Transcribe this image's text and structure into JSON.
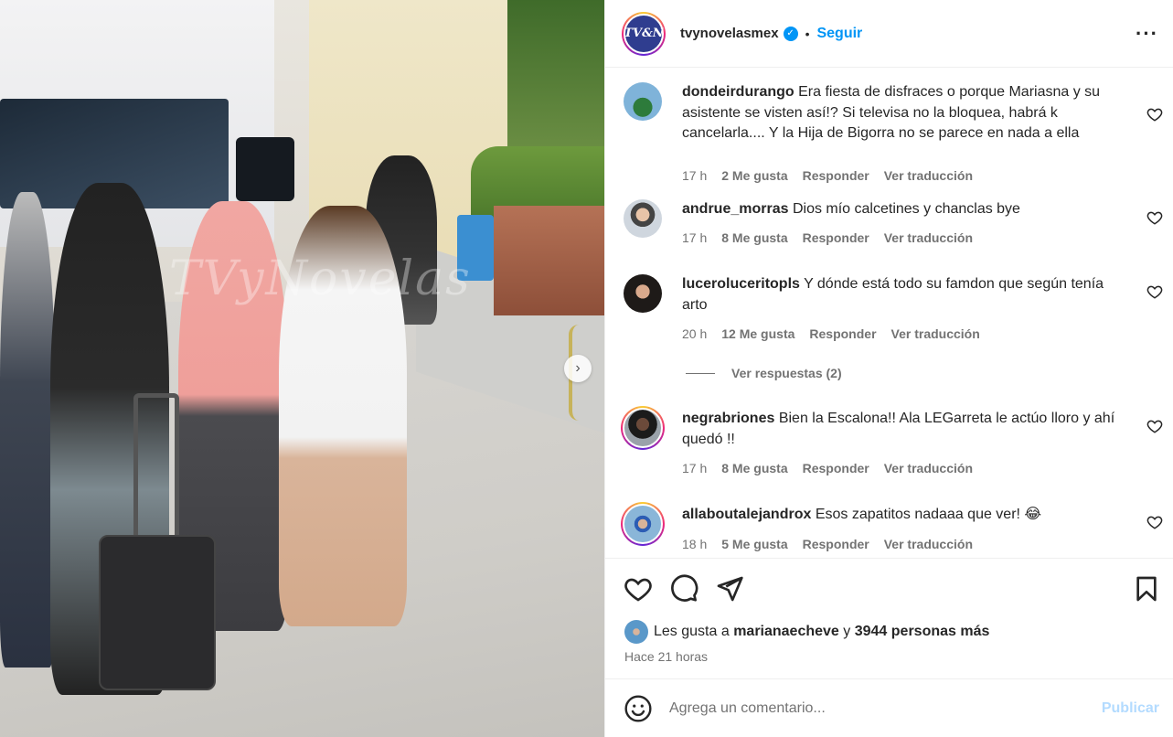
{
  "post": {
    "image_alt": "Street photo",
    "watermark": "TVyNovelas",
    "next_icon": "chevron-right-icon"
  },
  "header": {
    "avatar_text": "TV&N",
    "username": "tvynovelasmex",
    "verified_icon": "verified-badge-icon",
    "separator": "•",
    "follow_label": "Seguir",
    "more_icon": "more-options-icon"
  },
  "comments": [
    {
      "username": "dondeirdurango",
      "text": "Era fiesta de disfraces o porque Mariasna y su asistente se visten así!? Si televisa no la bloquea, habrá k cancelarla.... Y la Hija de Bigorra no se parece en nada a ella",
      "time": "17 h",
      "likes": "2 Me gusta",
      "reply": "Responder",
      "translate": "Ver traducción"
    },
    {
      "username": "andrue_morras",
      "text": "Dios mío calcetines y chanclas bye",
      "time": "17 h",
      "likes": "8 Me gusta",
      "reply": "Responder",
      "translate": "Ver traducción"
    },
    {
      "username": "luceroluceritopls",
      "text": "Y dónde está todo su famdon que según tenía arto",
      "time": "20 h",
      "likes": "12 Me gusta",
      "reply": "Responder",
      "translate": "Ver traducción",
      "view_replies": "Ver respuestas (2)"
    },
    {
      "username": "negrabriones",
      "text": "Bien la Escalona!! Ala LEGarreta le actúo lloro y ahí quedó !!",
      "time": "17 h",
      "likes": "8 Me gusta",
      "reply": "Responder",
      "translate": "Ver traducción"
    },
    {
      "username": "allaboutalejandrox",
      "text": "Esos zapatitos nadaaa que ver! 😂",
      "time": "18 h",
      "likes": "5 Me gusta",
      "reply": "Responder",
      "translate": "Ver traducción"
    }
  ],
  "actions": {
    "like_icon": "heart-icon",
    "comment_icon": "comment-icon",
    "share_icon": "share-icon",
    "save_icon": "bookmark-icon",
    "likes_prefix": "Les gusta a",
    "liked_by": "marianaecheve",
    "likes_and": "y",
    "likes_others": "3944 personas más",
    "time_ago": "Hace 21 horas"
  },
  "composer": {
    "emoji_icon": "emoji-icon",
    "placeholder": "Agrega un comentario...",
    "publish_label": "Publicar"
  },
  "colors": {
    "accent": "#0095f6",
    "publish_disabled": "#b3dbff",
    "meta_gray": "#737373",
    "text": "#262626"
  }
}
